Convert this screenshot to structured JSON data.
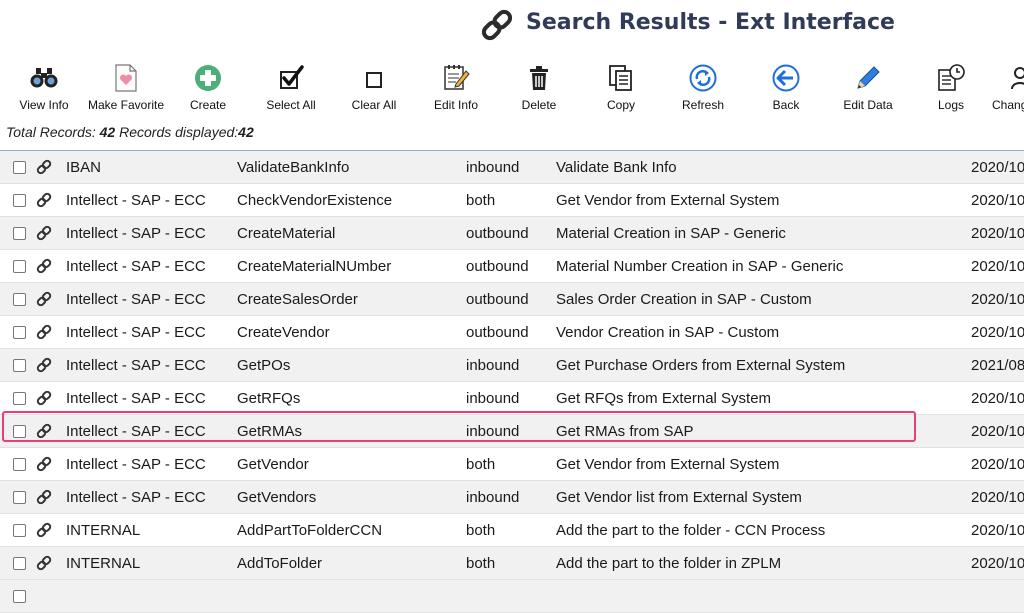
{
  "header": {
    "title": "Search Results - Ext Interface"
  },
  "toolbar": [
    {
      "label": "View Info",
      "icon": "binoculars-icon"
    },
    {
      "label": "Make Favorite",
      "icon": "heart-document-icon"
    },
    {
      "label": "Create",
      "icon": "plus-circle-icon"
    },
    {
      "label": "Select All",
      "icon": "checked-box-icon"
    },
    {
      "label": "Clear All",
      "icon": "empty-box-icon"
    },
    {
      "label": "Edit Info",
      "icon": "edit-note-icon"
    },
    {
      "label": "Delete",
      "icon": "trash-icon"
    },
    {
      "label": "Copy",
      "icon": "copy-icon"
    },
    {
      "label": "Refresh",
      "icon": "refresh-icon"
    },
    {
      "label": "Back",
      "icon": "back-arrow-icon"
    },
    {
      "label": "Edit Data",
      "icon": "pencil-icon"
    },
    {
      "label": "Logs",
      "icon": "logs-clock-icon"
    },
    {
      "label": "Chang",
      "icon": "user-icon"
    }
  ],
  "summary": {
    "total_label": "Total Records: ",
    "total_value": "42",
    "displayed_label": " Records displayed:",
    "displayed_value": "42"
  },
  "rows": [
    {
      "system": "IBAN",
      "name": "ValidateBankInfo",
      "direction": "inbound",
      "description": "Validate Bank Info",
      "date": "2020/10"
    },
    {
      "system": "Intellect - SAP - ECC",
      "name": "CheckVendorExistence",
      "direction": "both",
      "description": "Get Vendor from External System",
      "date": "2020/10"
    },
    {
      "system": "Intellect - SAP - ECC",
      "name": "CreateMaterial",
      "direction": "outbound",
      "description": "Material Creation in SAP - Generic",
      "date": "2020/10"
    },
    {
      "system": "Intellect - SAP - ECC",
      "name": "CreateMaterialNUmber",
      "direction": "outbound",
      "description": "Material Number Creation in SAP - Generic",
      "date": "2020/10"
    },
    {
      "system": "Intellect - SAP - ECC",
      "name": "CreateSalesOrder",
      "direction": "outbound",
      "description": "Sales Order Creation in SAP - Custom",
      "date": "2020/10"
    },
    {
      "system": "Intellect - SAP - ECC",
      "name": "CreateVendor",
      "direction": "outbound",
      "description": "Vendor Creation in SAP - Custom",
      "date": "2020/10"
    },
    {
      "system": "Intellect - SAP - ECC",
      "name": "GetPOs",
      "direction": "inbound",
      "description": "Get Purchase Orders from External System",
      "date": "2021/08"
    },
    {
      "system": "Intellect - SAP - ECC",
      "name": "GetRFQs",
      "direction": "inbound",
      "description": "Get RFQs from External System",
      "date": "2020/10"
    },
    {
      "system": "Intellect - SAP - ECC",
      "name": "GetRMAs",
      "direction": "inbound",
      "description": "Get RMAs from SAP",
      "date": "2020/10"
    },
    {
      "system": "Intellect - SAP - ECC",
      "name": "GetVendor",
      "direction": "both",
      "description": "Get Vendor from External System",
      "date": "2020/10"
    },
    {
      "system": "Intellect - SAP - ECC",
      "name": "GetVendors",
      "direction": "inbound",
      "description": "Get Vendor list from External System",
      "date": "2020/10"
    },
    {
      "system": "INTERNAL",
      "name": "AddPartToFolderCCN",
      "direction": "both",
      "description": "Add the part to the folder - CCN Process",
      "date": "2020/10"
    },
    {
      "system": "INTERNAL",
      "name": "AddToFolder",
      "direction": "both",
      "description": "Add the part to the folder in ZPLM",
      "date": "2020/10"
    }
  ],
  "colors": {
    "title": "#2f3b57",
    "highlight": "#e83e7e",
    "grid_border": "#8fb3d8",
    "create_green": "#4caf7a",
    "refresh_blue": "#1e6fd9"
  }
}
